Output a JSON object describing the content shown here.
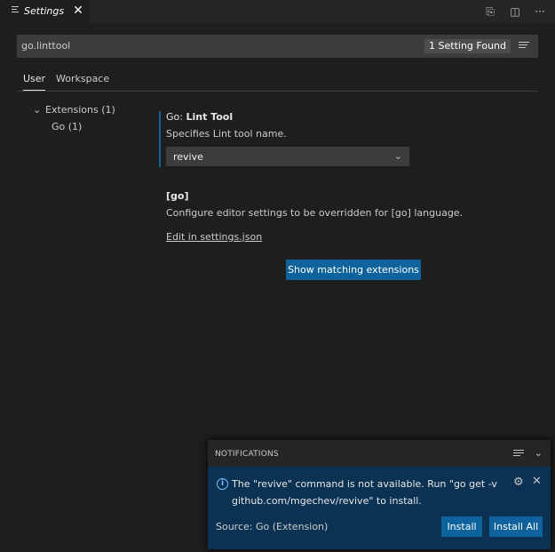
{
  "tab": {
    "title": "Settings",
    "close_glyph": "✕"
  },
  "editor_actions": [
    {
      "name": "open-settings-json-icon",
      "glyph": "⎘"
    },
    {
      "name": "split-editor-icon",
      "glyph": "◫"
    },
    {
      "name": "more-actions-icon",
      "glyph": "···"
    }
  ],
  "search": {
    "value": "go.linttool",
    "count": "1 Setting Found"
  },
  "scopes": {
    "user": "User",
    "workspace": "Workspace"
  },
  "toc": {
    "extensions": "Extensions (1)",
    "go": "Go (1)"
  },
  "setting": {
    "category": "Go: ",
    "name": "Lint Tool",
    "description": "Specifies Lint tool name.",
    "value": "revive"
  },
  "language": {
    "title": "[go]",
    "description": "Configure editor settings to be overridden for [go] language.",
    "edit_link": "Edit in settings.json"
  },
  "show_extensions_button": "Show matching extensions",
  "notifications": {
    "header": "NOTIFICATIONS",
    "message": "The \"revive\" command is not available. Run \"go get -v github.com/mgechev/revive\" to install.",
    "source": "Source: Go (Extension)",
    "install": "Install",
    "install_all": "Install All"
  },
  "colors": {
    "accent": "#0e639c",
    "notification_body": "#0b3253",
    "info_icon": "#75beff"
  }
}
